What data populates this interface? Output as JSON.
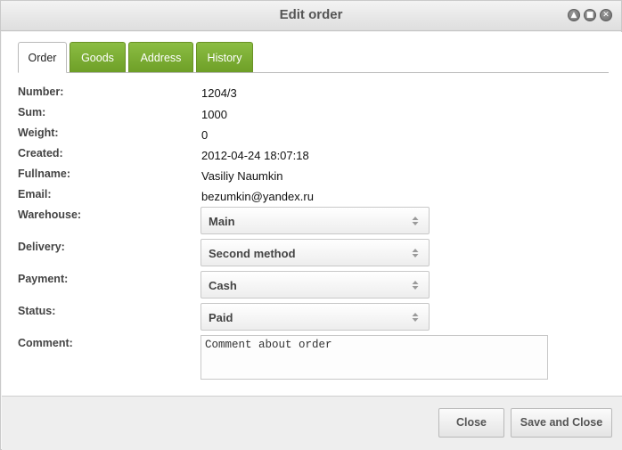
{
  "window": {
    "title": "Edit order",
    "controls": [
      {
        "name": "minimize-icon",
        "glyph": "▲"
      },
      {
        "name": "maximize-icon",
        "glyph": "■"
      },
      {
        "name": "close-icon",
        "glyph": "✕"
      }
    ]
  },
  "tabs": [
    {
      "label": "Order",
      "active": true
    },
    {
      "label": "Goods",
      "active": false
    },
    {
      "label": "Address",
      "active": false
    },
    {
      "label": "History",
      "active": false
    }
  ],
  "fields": {
    "number": {
      "label": "Number:",
      "value": "1204/3"
    },
    "sum": {
      "label": "Sum:",
      "value": "1000"
    },
    "weight": {
      "label": "Weight:",
      "value": "0"
    },
    "created": {
      "label": "Created:",
      "value": "2012-04-24 18:07:18"
    },
    "fullname": {
      "label": "Fullname:",
      "value": "Vasiliy Naumkin"
    },
    "email": {
      "label": "Email:",
      "value": "bezumkin@yandex.ru"
    },
    "warehouse": {
      "label": "Warehouse:",
      "value": "Main"
    },
    "delivery": {
      "label": "Delivery:",
      "value": "Second method"
    },
    "payment": {
      "label": "Payment:",
      "value": "Cash"
    },
    "status": {
      "label": "Status:",
      "value": "Paid"
    },
    "comment": {
      "label": "Comment:",
      "value": "Comment about order"
    }
  },
  "buttons": {
    "close": "Close",
    "save_close": "Save and Close"
  },
  "colors": {
    "tab_green": "#7aab30",
    "accent_text": "#444444"
  }
}
